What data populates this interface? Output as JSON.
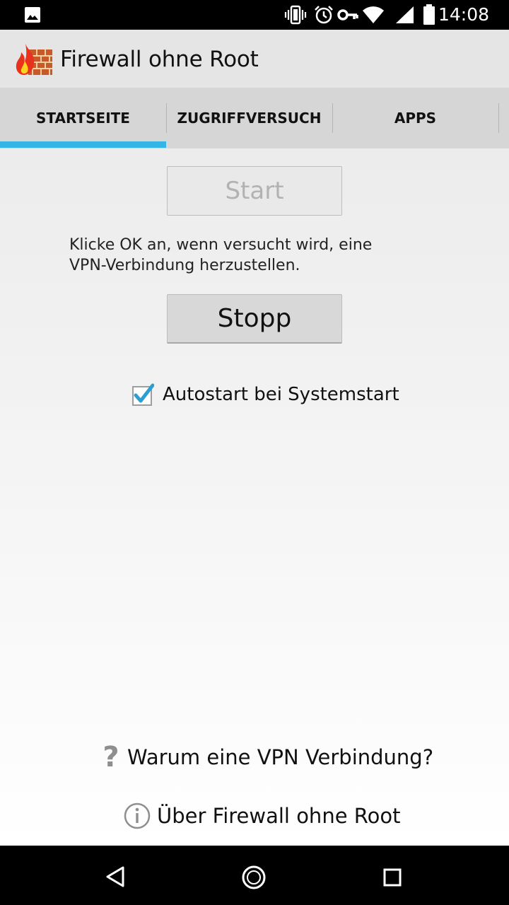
{
  "status_bar": {
    "time": "14:08",
    "icons": [
      "image-notification-icon",
      "vibrate-icon",
      "alarm-icon",
      "vpn-key-icon",
      "wifi-icon",
      "signal-icon",
      "battery-icon"
    ]
  },
  "app": {
    "title": "Firewall ohne Root",
    "logo_icon": "firewall-logo-icon"
  },
  "tabs": [
    {
      "label": "STARTSEITE",
      "selected": true
    },
    {
      "label": "ZUGRIFFVERSUCH",
      "selected": false
    },
    {
      "label": "APPS",
      "selected": false
    }
  ],
  "main": {
    "start_button": {
      "label": "Start",
      "enabled": false
    },
    "hint_text": "Klicke OK an, wenn versucht wird, eine VPN-Verbindung herzustellen.",
    "stop_button": {
      "label": "Stopp",
      "enabled": true
    },
    "autostart": {
      "label": "Autostart bei Systemstart",
      "checked": true
    }
  },
  "links": {
    "why_vpn": "Warum eine VPN Verbindung?",
    "about": "Über Firewall ohne Root"
  },
  "colors": {
    "accent": "#33b5e5",
    "action_bar": "#e5e5e5",
    "tab_bar": "#d6d6d6"
  },
  "nav_bar": [
    "back-icon",
    "home-icon",
    "recents-icon"
  ]
}
